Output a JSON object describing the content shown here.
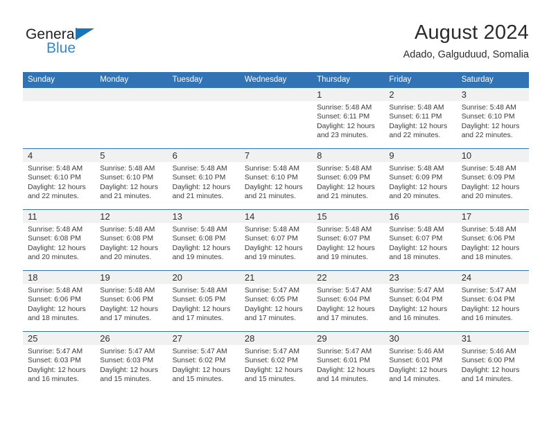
{
  "brand": {
    "name_part1": "General",
    "name_part2": "Blue",
    "triangle_color": "#1576bc",
    "blue_color": "#2e8ad4"
  },
  "header": {
    "title": "August 2024",
    "subtitle": "Adado, Galguduud, Somalia"
  },
  "theme": {
    "header_blue": "#3273b6",
    "daynum_band": "#f1f1f1"
  },
  "weekdays": [
    "Sunday",
    "Monday",
    "Tuesday",
    "Wednesday",
    "Thursday",
    "Friday",
    "Saturday"
  ],
  "weeks": [
    {
      "days": [
        {
          "num": "",
          "lines": [
            "",
            "",
            "",
            ""
          ]
        },
        {
          "num": "",
          "lines": [
            "",
            "",
            "",
            ""
          ]
        },
        {
          "num": "",
          "lines": [
            "",
            "",
            "",
            ""
          ]
        },
        {
          "num": "",
          "lines": [
            "",
            "",
            "",
            ""
          ]
        },
        {
          "num": "1",
          "lines": [
            "Sunrise: 5:48 AM",
            "Sunset: 6:11 PM",
            "Daylight: 12 hours",
            "and 23 minutes."
          ]
        },
        {
          "num": "2",
          "lines": [
            "Sunrise: 5:48 AM",
            "Sunset: 6:11 PM",
            "Daylight: 12 hours",
            "and 22 minutes."
          ]
        },
        {
          "num": "3",
          "lines": [
            "Sunrise: 5:48 AM",
            "Sunset: 6:10 PM",
            "Daylight: 12 hours",
            "and 22 minutes."
          ]
        }
      ]
    },
    {
      "days": [
        {
          "num": "4",
          "lines": [
            "Sunrise: 5:48 AM",
            "Sunset: 6:10 PM",
            "Daylight: 12 hours",
            "and 22 minutes."
          ]
        },
        {
          "num": "5",
          "lines": [
            "Sunrise: 5:48 AM",
            "Sunset: 6:10 PM",
            "Daylight: 12 hours",
            "and 21 minutes."
          ]
        },
        {
          "num": "6",
          "lines": [
            "Sunrise: 5:48 AM",
            "Sunset: 6:10 PM",
            "Daylight: 12 hours",
            "and 21 minutes."
          ]
        },
        {
          "num": "7",
          "lines": [
            "Sunrise: 5:48 AM",
            "Sunset: 6:10 PM",
            "Daylight: 12 hours",
            "and 21 minutes."
          ]
        },
        {
          "num": "8",
          "lines": [
            "Sunrise: 5:48 AM",
            "Sunset: 6:09 PM",
            "Daylight: 12 hours",
            "and 21 minutes."
          ]
        },
        {
          "num": "9",
          "lines": [
            "Sunrise: 5:48 AM",
            "Sunset: 6:09 PM",
            "Daylight: 12 hours",
            "and 20 minutes."
          ]
        },
        {
          "num": "10",
          "lines": [
            "Sunrise: 5:48 AM",
            "Sunset: 6:09 PM",
            "Daylight: 12 hours",
            "and 20 minutes."
          ]
        }
      ]
    },
    {
      "days": [
        {
          "num": "11",
          "lines": [
            "Sunrise: 5:48 AM",
            "Sunset: 6:08 PM",
            "Daylight: 12 hours",
            "and 20 minutes."
          ]
        },
        {
          "num": "12",
          "lines": [
            "Sunrise: 5:48 AM",
            "Sunset: 6:08 PM",
            "Daylight: 12 hours",
            "and 20 minutes."
          ]
        },
        {
          "num": "13",
          "lines": [
            "Sunrise: 5:48 AM",
            "Sunset: 6:08 PM",
            "Daylight: 12 hours",
            "and 19 minutes."
          ]
        },
        {
          "num": "14",
          "lines": [
            "Sunrise: 5:48 AM",
            "Sunset: 6:07 PM",
            "Daylight: 12 hours",
            "and 19 minutes."
          ]
        },
        {
          "num": "15",
          "lines": [
            "Sunrise: 5:48 AM",
            "Sunset: 6:07 PM",
            "Daylight: 12 hours",
            "and 19 minutes."
          ]
        },
        {
          "num": "16",
          "lines": [
            "Sunrise: 5:48 AM",
            "Sunset: 6:07 PM",
            "Daylight: 12 hours",
            "and 18 minutes."
          ]
        },
        {
          "num": "17",
          "lines": [
            "Sunrise: 5:48 AM",
            "Sunset: 6:06 PM",
            "Daylight: 12 hours",
            "and 18 minutes."
          ]
        }
      ]
    },
    {
      "days": [
        {
          "num": "18",
          "lines": [
            "Sunrise: 5:48 AM",
            "Sunset: 6:06 PM",
            "Daylight: 12 hours",
            "and 18 minutes."
          ]
        },
        {
          "num": "19",
          "lines": [
            "Sunrise: 5:48 AM",
            "Sunset: 6:06 PM",
            "Daylight: 12 hours",
            "and 17 minutes."
          ]
        },
        {
          "num": "20",
          "lines": [
            "Sunrise: 5:48 AM",
            "Sunset: 6:05 PM",
            "Daylight: 12 hours",
            "and 17 minutes."
          ]
        },
        {
          "num": "21",
          "lines": [
            "Sunrise: 5:47 AM",
            "Sunset: 6:05 PM",
            "Daylight: 12 hours",
            "and 17 minutes."
          ]
        },
        {
          "num": "22",
          "lines": [
            "Sunrise: 5:47 AM",
            "Sunset: 6:04 PM",
            "Daylight: 12 hours",
            "and 17 minutes."
          ]
        },
        {
          "num": "23",
          "lines": [
            "Sunrise: 5:47 AM",
            "Sunset: 6:04 PM",
            "Daylight: 12 hours",
            "and 16 minutes."
          ]
        },
        {
          "num": "24",
          "lines": [
            "Sunrise: 5:47 AM",
            "Sunset: 6:04 PM",
            "Daylight: 12 hours",
            "and 16 minutes."
          ]
        }
      ]
    },
    {
      "days": [
        {
          "num": "25",
          "lines": [
            "Sunrise: 5:47 AM",
            "Sunset: 6:03 PM",
            "Daylight: 12 hours",
            "and 16 minutes."
          ]
        },
        {
          "num": "26",
          "lines": [
            "Sunrise: 5:47 AM",
            "Sunset: 6:03 PM",
            "Daylight: 12 hours",
            "and 15 minutes."
          ]
        },
        {
          "num": "27",
          "lines": [
            "Sunrise: 5:47 AM",
            "Sunset: 6:02 PM",
            "Daylight: 12 hours",
            "and 15 minutes."
          ]
        },
        {
          "num": "28",
          "lines": [
            "Sunrise: 5:47 AM",
            "Sunset: 6:02 PM",
            "Daylight: 12 hours",
            "and 15 minutes."
          ]
        },
        {
          "num": "29",
          "lines": [
            "Sunrise: 5:47 AM",
            "Sunset: 6:01 PM",
            "Daylight: 12 hours",
            "and 14 minutes."
          ]
        },
        {
          "num": "30",
          "lines": [
            "Sunrise: 5:46 AM",
            "Sunset: 6:01 PM",
            "Daylight: 12 hours",
            "and 14 minutes."
          ]
        },
        {
          "num": "31",
          "lines": [
            "Sunrise: 5:46 AM",
            "Sunset: 6:00 PM",
            "Daylight: 12 hours",
            "and 14 minutes."
          ]
        }
      ]
    }
  ]
}
